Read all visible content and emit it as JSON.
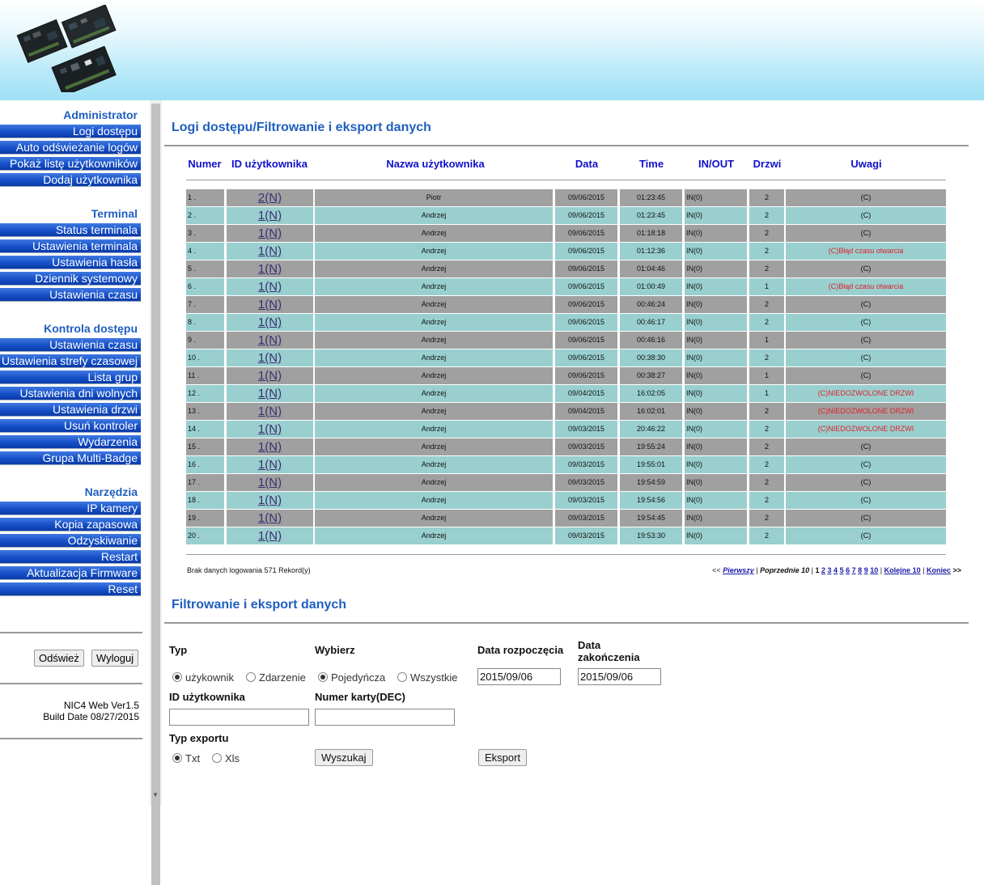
{
  "sidebar": {
    "sections": [
      {
        "title": "Administrator",
        "items": [
          "Logi dostępu",
          "Auto odświeżanie logów",
          "Pokaż listę użytkowników",
          "Dodaj użytkownika"
        ]
      },
      {
        "title": "Terminal",
        "items": [
          "Status terminala",
          "Ustawienia terminala",
          "Ustawienia hasła",
          "Dziennik systemowy",
          "Ustawienia czasu"
        ]
      },
      {
        "title": "Kontrola dostępu",
        "items": [
          "Ustawienia czasu",
          "Ustawienia strefy czasowej",
          "Lista grup",
          "Ustawienia dni wolnych",
          "Ustawienia drzwi",
          "Usuń kontroler",
          "Wydarzenia",
          "Grupa Multi-Badge"
        ]
      },
      {
        "title": "Narzędzia",
        "items": [
          "IP kamery",
          "Kopia zapasowa",
          "Odzyskiwanie",
          "Restart",
          "Aktualizacja Firmware",
          "Reset"
        ]
      }
    ],
    "refresh_label": "Odśwież",
    "logout_label": "Wyloguj",
    "version": "NIC4 Web Ver1.5",
    "build_date": "Build Date 08/27/2015"
  },
  "logs": {
    "title": "Logi dostępu/Filtrowanie i eksport danych",
    "columns": [
      "Numer",
      "ID użytkownika",
      "Nazwa użytkownika",
      "Data",
      "Time",
      "IN/OUT",
      "Drzwi",
      "Uwagi"
    ],
    "rows": [
      [
        "1 .",
        "2(N)",
        "Piotr",
        "09/06/2015",
        "01:23:45",
        "IN(0)",
        "2",
        "(C)"
      ],
      [
        "2 .",
        "1(N)",
        "Andrzej",
        "09/06/2015",
        "01:23:45",
        "IN(0)",
        "2",
        "(C)"
      ],
      [
        "3 .",
        "1(N)",
        "Andrzej",
        "09/06/2015",
        "01:18:18",
        "IN(0)",
        "2",
        "(C)"
      ],
      [
        "4 .",
        "1(N)",
        "Andrzej",
        "09/06/2015",
        "01:12:36",
        "IN(0)",
        "2",
        "(C)Błąd czasu otwarcia"
      ],
      [
        "5 .",
        "1(N)",
        "Andrzej",
        "09/06/2015",
        "01:04:46",
        "IN(0)",
        "2",
        "(C)"
      ],
      [
        "6 .",
        "1(N)",
        "Andrzej",
        "09/06/2015",
        "01:00:49",
        "IN(0)",
        "1",
        "(C)Błąd czasu otwarcia"
      ],
      [
        "7 .",
        "1(N)",
        "Andrzej",
        "09/06/2015",
        "00:46:24",
        "IN(0)",
        "2",
        "(C)"
      ],
      [
        "8 .",
        "1(N)",
        "Andrzej",
        "09/06/2015",
        "00:46:17",
        "IN(0)",
        "2",
        "(C)"
      ],
      [
        "9 .",
        "1(N)",
        "Andrzej",
        "09/06/2015",
        "00:46:16",
        "IN(0)",
        "1",
        "(C)"
      ],
      [
        "10 .",
        "1(N)",
        "Andrzej",
        "09/06/2015",
        "00:38:30",
        "IN(0)",
        "2",
        "(C)"
      ],
      [
        "11 .",
        "1(N)",
        "Andrzej",
        "09/06/2015",
        "00:38:27",
        "IN(0)",
        "1",
        "(C)"
      ],
      [
        "12 .",
        "1(N)",
        "Andrzej",
        "09/04/2015",
        "16:02:05",
        "IN(0)",
        "1",
        "(C)NIEDOZWOLONE DRZWI"
      ],
      [
        "13 .",
        "1(N)",
        "Andrzej",
        "09/04/2015",
        "16:02:01",
        "IN(0)",
        "2",
        "(C)NIEDOZWOLONE DRZWI"
      ],
      [
        "14 .",
        "1(N)",
        "Andrzej",
        "09/03/2015",
        "20:46:22",
        "IN(0)",
        "2",
        "(C)NIEDOZWOLONE DRZWI"
      ],
      [
        "15 .",
        "1(N)",
        "Andrzej",
        "09/03/2015",
        "19:55:24",
        "IN(0)",
        "2",
        "(C)"
      ],
      [
        "16 .",
        "1(N)",
        "Andrzej",
        "09/03/2015",
        "19:55:01",
        "IN(0)",
        "2",
        "(C)"
      ],
      [
        "17 .",
        "1(N)",
        "Andrzej",
        "09/03/2015",
        "19:54:59",
        "IN(0)",
        "2",
        "(C)"
      ],
      [
        "18 .",
        "1(N)",
        "Andrzej",
        "09/03/2015",
        "19:54:56",
        "IN(0)",
        "2",
        "(C)"
      ],
      [
        "19 .",
        "1(N)",
        "Andrzej",
        "09/03/2015",
        "19:54:45",
        "IN(0)",
        "2",
        "(C)"
      ],
      [
        "20 .",
        "1(N)",
        "Andrzej",
        "09/03/2015",
        "19:53:30",
        "IN(0)",
        "2",
        "(C)"
      ]
    ],
    "row_colors": {
      "odd": "#a0a0a0",
      "even": "#99cfcf",
      "alert_text": "#e0202a"
    },
    "record_info": "Brak danych logowania 571 Rekord(y)",
    "pager": {
      "first_prefix": "<<",
      "first": "Pierwszy",
      "prev": "Poprzednie 10",
      "current": "1",
      "pages": [
        "2",
        "3",
        "4",
        "5",
        "6",
        "7",
        "8",
        "9",
        "10"
      ],
      "next": "Kolejne 10",
      "last": "Koniec",
      "last_suffix": ">>"
    }
  },
  "filter": {
    "title": "Filtrowanie i eksport danych",
    "type_label": "Typ",
    "type_options": [
      {
        "label": "użykownik",
        "checked": true
      },
      {
        "label": "Zdarzenie",
        "checked": false
      }
    ],
    "select_label": "Wybierz",
    "select_options": [
      {
        "label": "Pojedyńcza",
        "checked": true
      },
      {
        "label": "Wszystkie",
        "checked": false
      }
    ],
    "start_label": "Data rozpoczęcia",
    "start_value": "2015/09/06",
    "end_label_1": "Data",
    "end_label_2": "zakończenia",
    "end_value": "2015/09/06",
    "user_id_label": "ID użytkownika",
    "card_label": "Numer karty(DEC)",
    "user_id_value": "",
    "card_value": "",
    "export_type_label": "Typ exportu",
    "export_options": [
      {
        "label": "Txt",
        "checked": true
      },
      {
        "label": "Xls",
        "checked": false
      }
    ],
    "search_label": "Wyszukaj",
    "export_label": "Eksport"
  }
}
